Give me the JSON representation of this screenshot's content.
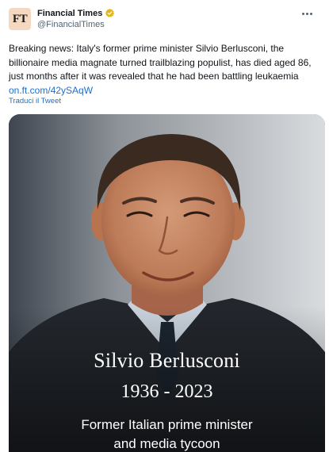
{
  "tweet": {
    "avatar_text": "FT",
    "display_name": "Financial Times",
    "handle": "@FinancialTimes",
    "body": "Breaking news: Italy's former prime minister Silvio Berlusconi, the billionaire media magnate turned trailblazing populist, has died aged 86, just months after it was revealed that he had been battling leukaemia",
    "link": "on.ft.com/42ySAqW",
    "translate_label": "Traduci il Tweet"
  },
  "media": {
    "caption_name": "Silvio Berlusconi",
    "caption_years": "1936 - 2023",
    "caption_line1": "Former Italian prime minister",
    "caption_line2": "and media tycoon"
  },
  "colors": {
    "link": "#1d6fc9",
    "verified_badge": "#e2b719",
    "avatar_bg": "#f4d9c0"
  },
  "icons": {
    "verified": "verified-badge-icon",
    "more": "more-options-icon"
  }
}
